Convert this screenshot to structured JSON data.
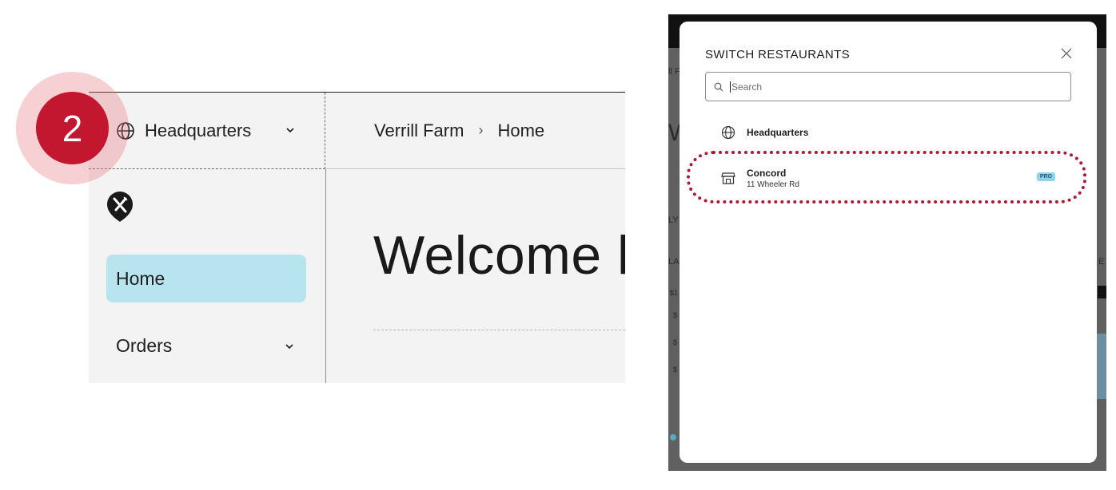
{
  "step": {
    "number": "2"
  },
  "zoom": {
    "location_switcher": {
      "label": "Headquarters",
      "icon": "globe-icon"
    },
    "breadcrumb": {
      "items": [
        "Verrill Farm",
        "Home"
      ],
      "separator": "›"
    },
    "nav": {
      "items": [
        {
          "label": "Home",
          "active": true
        },
        {
          "label": "Orders",
          "expandable": true
        }
      ]
    },
    "heading": "Welcome l"
  },
  "app": {
    "background_fragments": [
      "ll F",
      "W",
      "LY",
      "LA",
      "E",
      "$1",
      "$",
      "$",
      "$"
    ],
    "modal": {
      "title": "SWITCH RESTAURANTS",
      "search": {
        "placeholder": "Search",
        "value": ""
      },
      "restaurants": [
        {
          "name": "Headquarters",
          "icon": "globe-icon"
        },
        {
          "name": "Concord",
          "address": "11 Wheeler Rd",
          "icon": "store-icon",
          "badge": "PRO"
        }
      ]
    }
  },
  "colors": {
    "step_marker": "#c3162f",
    "highlight": "#b01533",
    "nav_active_bg": "#b8e4f0",
    "pro_badge_bg": "#8fd2ea"
  }
}
